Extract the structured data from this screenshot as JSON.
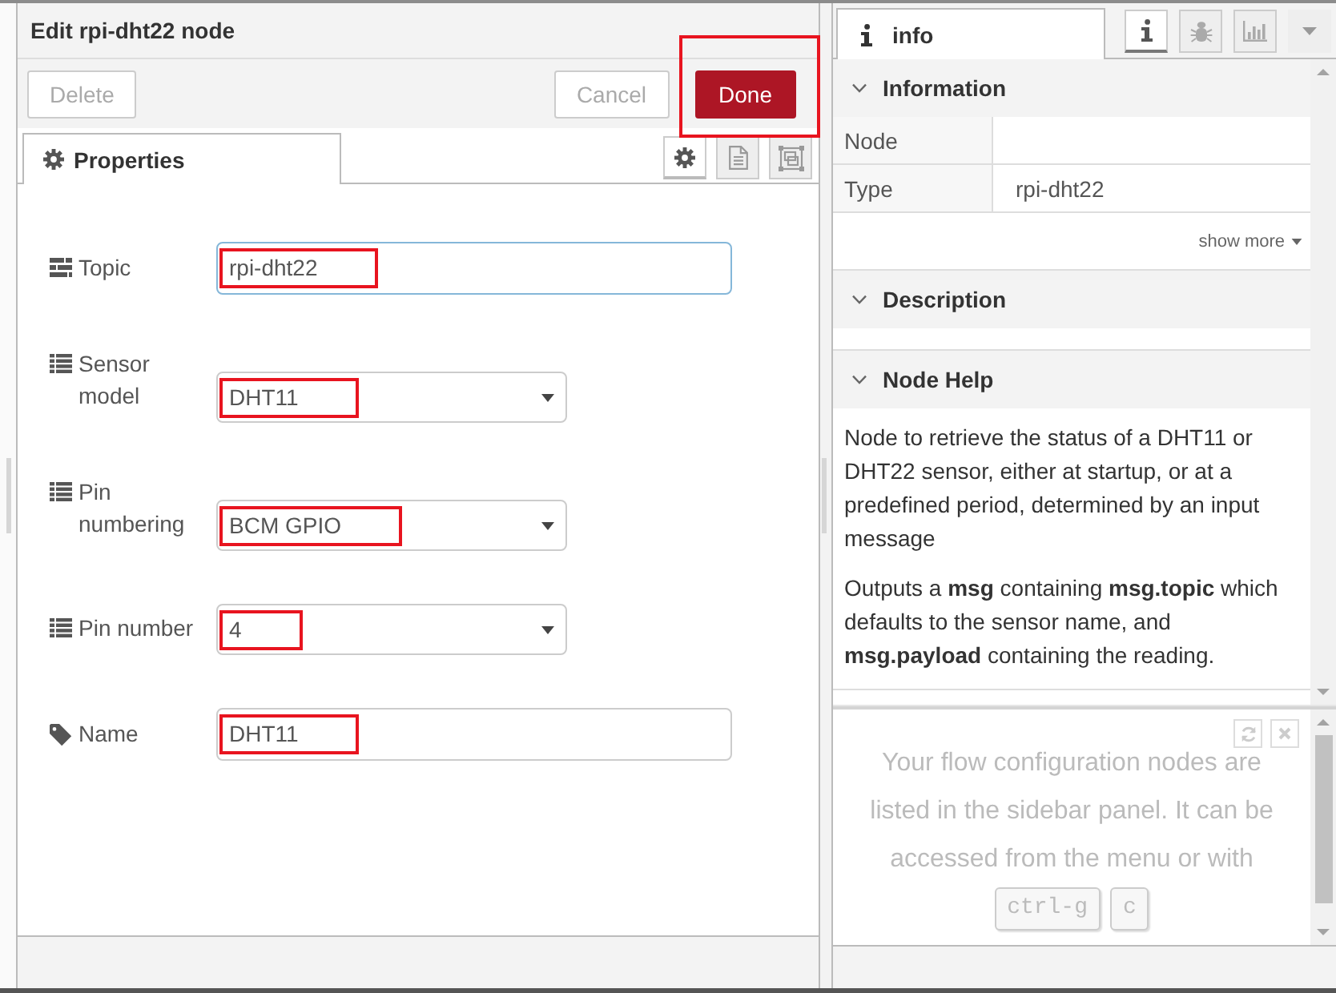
{
  "editor": {
    "title": "Edit rpi-dht22 node",
    "left_buttons": [
      {
        "label": "Delete",
        "kind": "plain",
        "highlighted": false
      }
    ],
    "right_buttons": [
      {
        "label": "Cancel",
        "kind": "plain",
        "highlighted": false
      },
      {
        "label": "Done",
        "kind": "primary",
        "highlighted": true
      }
    ],
    "tabs": [
      {
        "label": "Properties",
        "selected": true
      }
    ],
    "tab_buttons": [
      {
        "kind": "gear",
        "selected": true
      },
      {
        "kind": "document",
        "selected": false
      },
      {
        "kind": "frame",
        "selected": false
      }
    ],
    "fields": [
      {
        "kind": "text",
        "label": "Topic",
        "value": "rpi-dht22",
        "focused": true,
        "highlighted": true
      },
      {
        "kind": "select",
        "label": "Sensor model",
        "value": "DHT11",
        "focused": false,
        "highlighted": true
      },
      {
        "kind": "select",
        "label": "Pin numbering",
        "value": "BCM GPIO",
        "focused": false,
        "highlighted": true
      },
      {
        "kind": "select",
        "label": "Pin number",
        "value": "4",
        "focused": false,
        "highlighted": true
      },
      {
        "kind": "text",
        "label": "Name",
        "value": "DHT11",
        "focused": false,
        "highlighted": true
      }
    ]
  },
  "sidebar": {
    "tabs": [
      {
        "label": "info",
        "selected": true
      }
    ],
    "tool_buttons": [
      {
        "kind": "info",
        "selected": true
      },
      {
        "kind": "bug",
        "selected": false
      },
      {
        "kind": "chart",
        "selected": false
      },
      {
        "kind": "menu",
        "selected": false
      }
    ],
    "sections": [
      {
        "kind": "table",
        "title": "Information",
        "expanded": true,
        "rows": [
          {
            "label": "Node"
          },
          {
            "label": "Type",
            "value": "rpi-dht22"
          }
        ],
        "show_more": "show more"
      },
      {
        "kind": "text",
        "title": "Description",
        "expanded": true
      },
      {
        "kind": "text",
        "title": "Node Help",
        "expanded": true,
        "paragraphs": [
          "Node to retrieve the status of a DHT11 or DHT22 sensor, either at startup, or at a predefined period, determined by an input message",
          "Outputs a **msg** containing **msg.topic** which defaults to the sensor name, and **msg.payload** containing the reading."
        ]
      }
    ],
    "config_panel": {
      "message": "Your flow configuration nodes are listed in the sidebar panel. It can be accessed from the menu or with",
      "keys": [
        "ctrl-g",
        "c"
      ]
    }
  }
}
